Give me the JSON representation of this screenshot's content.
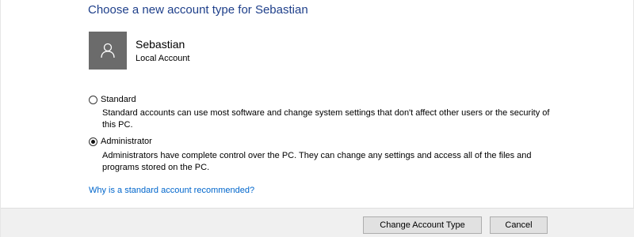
{
  "title": "Choose a new account type for Sebastian",
  "account": {
    "avatar_icon": "user-icon",
    "name": "Sebastian",
    "type": "Local Account"
  },
  "options": [
    {
      "label": "Standard",
      "selected": false,
      "description": "Standard accounts can use most software and change system settings that don't affect other users or the security of this PC."
    },
    {
      "label": "Administrator",
      "selected": true,
      "description": "Administrators have complete control over the PC. They can change any settings and access all of the files and programs stored on the PC."
    }
  ],
  "help_link": "Why is a standard account recommended?",
  "buttons": {
    "change": "Change Account Type",
    "cancel": "Cancel"
  },
  "colors": {
    "title": "#1e3f8a",
    "link": "#0066cc",
    "avatar_bg": "#6b6b6b"
  }
}
